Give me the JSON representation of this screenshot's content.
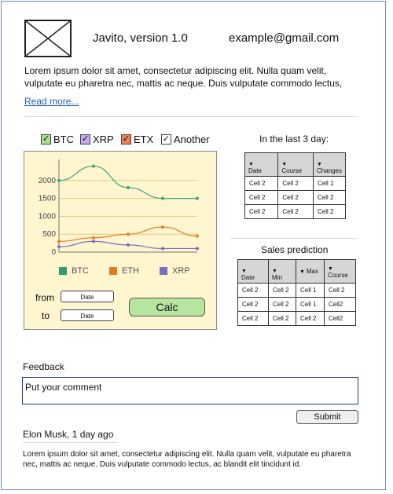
{
  "header": {
    "title": "Javito, version 1.0",
    "email": "example@gmail.com",
    "logo_icon": "image-placeholder-icon"
  },
  "intro": {
    "text": "Lorem ipsum dolor sit amet, consectetur adipiscing elit. Nulla quam velit, vulputate eu pharetra nec, mattis ac neque. Duis vulputate commodo lectus,",
    "read_more": "Read more..."
  },
  "filters": [
    {
      "label": "BTC",
      "checked": true,
      "color": "#a6e38f"
    },
    {
      "label": "XRP",
      "checked": true,
      "color": "#c7a6f2"
    },
    {
      "label": "ETX",
      "checked": true,
      "color": "#f0804f"
    },
    {
      "label": "Another",
      "checked": true,
      "color": "#ffffff"
    }
  ],
  "chart_data": {
    "type": "line",
    "x": [
      1,
      2,
      3,
      4,
      5
    ],
    "ylim": [
      0,
      2500
    ],
    "yticks": [
      "0",
      "500",
      "1000",
      "1500",
      "2000"
    ],
    "grid": true,
    "series": [
      {
        "name": "BTC",
        "color": "#3aa57a",
        "values": [
          2000,
          2400,
          1800,
          1500,
          1500
        ]
      },
      {
        "name": "ETH",
        "color": "#e67e22",
        "values": [
          300,
          400,
          500,
          700,
          450
        ]
      },
      {
        "name": "XRP",
        "color": "#8068c4",
        "values": [
          150,
          300,
          200,
          100,
          100
        ]
      }
    ]
  },
  "legend": [
    {
      "label": "BTC",
      "color": "#2e9c6f"
    },
    {
      "label": "ETH",
      "color": "#e07b1a"
    },
    {
      "label": "XRP",
      "color": "#7b6dc0"
    }
  ],
  "date_range": {
    "from_label": "from",
    "to_label": "to",
    "from_placeholder": "Date",
    "to_placeholder": "Date",
    "calc_label": "Calc"
  },
  "recent": {
    "title": "In the last 3 day:",
    "headers": [
      "Date",
      "Course",
      "Changes"
    ],
    "rows": [
      [
        "Cell 2",
        "Cell 2",
        "Cell 1"
      ],
      [
        "Cell 2",
        "Cell 2",
        "Cell 2"
      ],
      [
        "Cell 2",
        "Cell 2",
        "Cell 2"
      ]
    ]
  },
  "prediction": {
    "title": "Sales prediction",
    "headers": [
      "Date",
      "Min",
      "Max",
      "Course"
    ],
    "rows": [
      [
        "Cell 2",
        "Cell 2",
        "Cell 1",
        "Cell 2"
      ],
      [
        "Cell 2",
        "Cell 2",
        "Cell 1",
        "Cell2"
      ],
      [
        "Cell 2",
        "Cell 2",
        "Cell 2",
        "Cell2"
      ]
    ]
  },
  "feedback": {
    "label": "Feedback",
    "placeholder": "Put your comment",
    "submit_label": "Submit"
  },
  "comment": {
    "author": "Elon Musk, 1 day ago",
    "text": "Lorem ipsum dolor sit amet, consectetur adipiscing elit. Nulla quam velit, vulputate eu pharetra nec, mattis ac neque. Duis vulputate commodo lectus, ac blandit elit tincidunt id."
  }
}
